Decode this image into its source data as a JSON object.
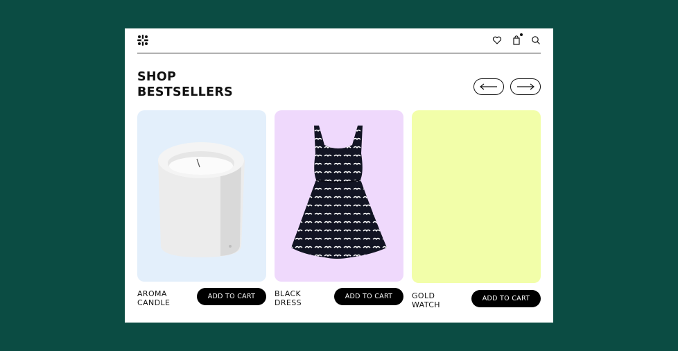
{
  "header": {
    "logo_icon": "flower-logo-icon",
    "icons": [
      "heart-icon",
      "shopping-bag-icon",
      "search-icon"
    ]
  },
  "section": {
    "title_line1": "SHOP",
    "title_line2": "BESTSELLERS",
    "prev_icon": "arrow-left-icon",
    "next_icon": "arrow-right-icon"
  },
  "products": [
    {
      "name_line1": "AROMA",
      "name_line2": "CANDLE",
      "button": "ADD TO CART",
      "bg": "#e3effb"
    },
    {
      "name_line1": "BLACK",
      "name_line2": "DRESS",
      "button": "ADD TO CART",
      "bg": "#efd9fc"
    },
    {
      "name_line1": "GOLD",
      "name_line2": "WATCH",
      "button": "ADD TO CART",
      "bg": "#f2fea9"
    }
  ],
  "colors": {
    "background": "#0b4c43",
    "panel": "#ffffff",
    "button": "#000000"
  }
}
